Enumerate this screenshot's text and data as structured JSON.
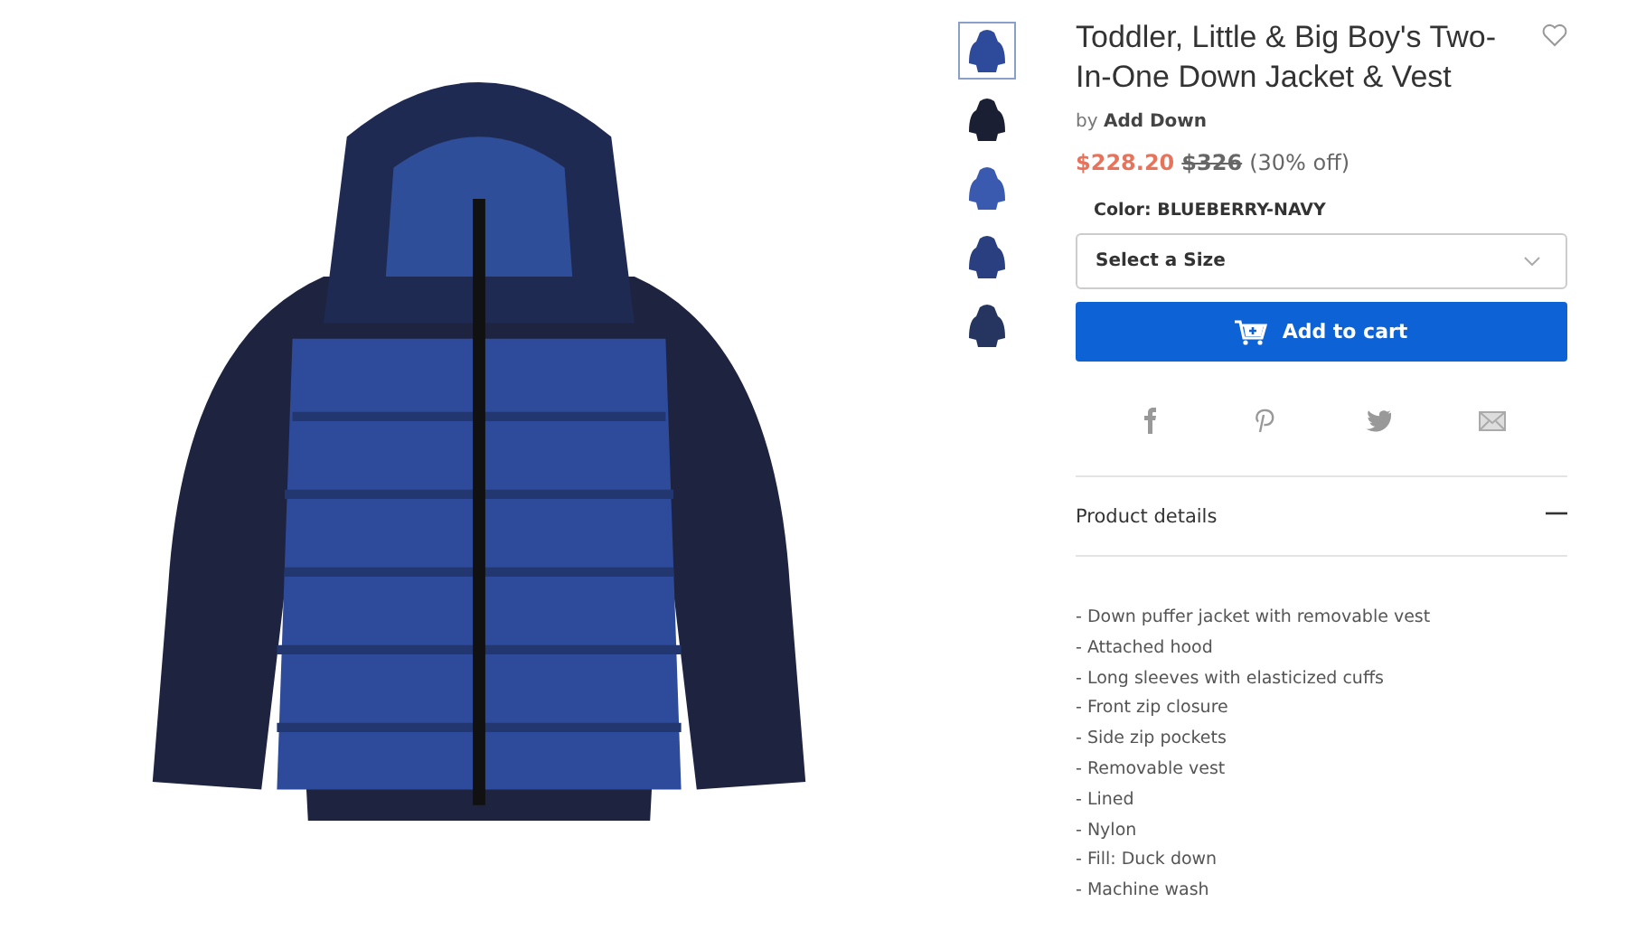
{
  "thumbnails": [
    {
      "kind": "front",
      "selected": true
    },
    {
      "kind": "dark",
      "selected": false
    },
    {
      "kind": "vest",
      "selected": false
    },
    {
      "kind": "back",
      "selected": false
    },
    {
      "kind": "outfit",
      "selected": false
    }
  ],
  "product": {
    "title": "Toddler, Little & Big Boy's Two-In-One Down Jacket & Vest",
    "by": "by",
    "brand": "Add Down",
    "sale_price": "$228.20",
    "original_price": "$326",
    "discount": "(30% off)",
    "favorite": false
  },
  "color": {
    "label": "Color:",
    "value": "BLUEBERRY-NAVY"
  },
  "size_select": {
    "placeholder": "Select a Size"
  },
  "add_to_cart": "Add to cart",
  "share": [
    {
      "kind": "facebook"
    },
    {
      "kind": "pinterest"
    },
    {
      "kind": "twitter"
    },
    {
      "kind": "email"
    }
  ],
  "details": {
    "title": "Product details",
    "expanded": true,
    "items": [
      "- Down puffer jacket with removable vest",
      "- Attached hood",
      "- Long sleeves with elasticized cuffs",
      "- Front zip closure",
      "- Side zip pockets",
      "- Removable vest",
      "- Lined",
      "- Nylon",
      "- Fill: Duck down",
      "- Machine wash"
    ]
  }
}
